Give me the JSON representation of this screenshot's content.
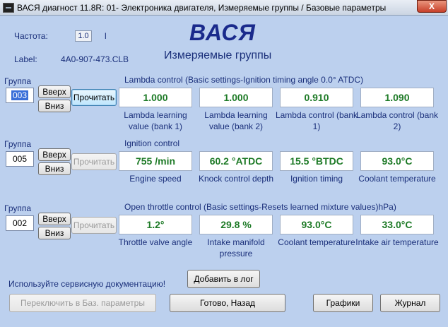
{
  "window": {
    "title": "ВАСЯ диагност 11.8R: 01- Электроника двигателя,  Измеряемые группы / Базовые параметры",
    "close_glyph": "X"
  },
  "header": {
    "freq_label": "Частота:",
    "freq_value": "1.0",
    "freq_unit": "l",
    "label_caption": "Label:",
    "label_value": "4A0-907-473.CLB",
    "brand": "ВАСЯ",
    "subtitle": "Измеряемые группы"
  },
  "groups": [
    {
      "label": "Группа",
      "number": "003",
      "up": "Вверх",
      "down": "Вниз",
      "read": "Прочитать",
      "title": "Lambda control (Basic settings-Ignition timing angle 0.0° ATDC)",
      "fields": [
        {
          "value": "1.000",
          "desc": "Lambda learning value (bank 1)"
        },
        {
          "value": "1.000",
          "desc": "Lambda learning value (bank 2)"
        },
        {
          "value": "0.910",
          "desc": "Lambda control (bank 1)"
        },
        {
          "value": "1.090",
          "desc": "Lambda control (bank 2)"
        }
      ]
    },
    {
      "label": "Группа",
      "number": "005",
      "up": "Вверх",
      "down": "Вниз",
      "read": "Прочитать",
      "title": "Ignition control",
      "fields": [
        {
          "value": "755 /min",
          "desc": "Engine speed"
        },
        {
          "value": "60.2 °ATDC",
          "desc": "Knock control depth"
        },
        {
          "value": "15.5 °BTDC",
          "desc": "Ignition timing"
        },
        {
          "value": "93.0°C",
          "desc": "Coolant temperature"
        }
      ]
    },
    {
      "label": "Группа",
      "number": "002",
      "up": "Вверх",
      "down": "Вниз",
      "read": "Прочитать",
      "title": "Open throttle control (Basic settings-Resets learned mixture values)hPa)",
      "fields": [
        {
          "value": "1.2°",
          "desc": "Throttle valve angle"
        },
        {
          "value": "29.8 %",
          "desc": "Intake manifold pressure"
        },
        {
          "value": "93.0°C",
          "desc": "Coolant temperature"
        },
        {
          "value": "33.0°C",
          "desc": "Intake air temperature"
        }
      ]
    }
  ],
  "footer": {
    "doc_hint": "Используйте сервисную документацию!",
    "add_log": "Добавить в лог",
    "switch_basic": "Переключить в Баз. параметры",
    "done_back": "Готово, Назад",
    "graphs": "Графики",
    "journal": "Журнал"
  }
}
